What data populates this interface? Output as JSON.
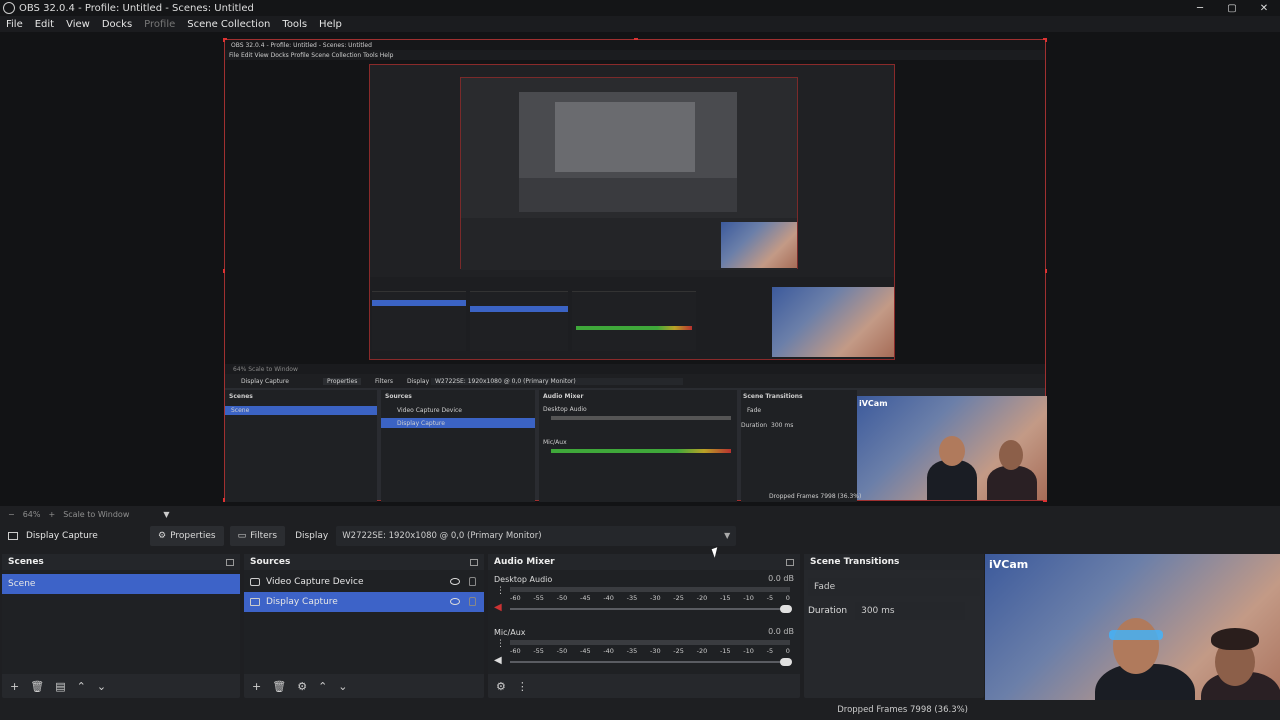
{
  "window": {
    "title": "OBS 32.0.4 - Profile: Untitled - Scenes: Untitled",
    "minimize": "─",
    "maximize": "▢",
    "close": "✕"
  },
  "menu": [
    "File",
    "Edit",
    "View",
    "Docks",
    "Profile",
    "Scene Collection",
    "Tools",
    "Help"
  ],
  "nested": {
    "title": "OBS 32.0.4 - Profile: Untitled - Scenes: Untitled",
    "menu": "File   Edit   View   Docks   Profile   Scene Collection   Tools   Help",
    "zoom": "64%   Scale to Window",
    "source_name": "Display Capture",
    "properties": "Properties",
    "filters": "Filters",
    "display_label": "Display",
    "display_value": "W2722SE: 1920x1080 @ 0,0 (Primary Monitor)",
    "scenes": "Scenes",
    "scene_item": "Scene",
    "sources": "Sources",
    "src1": "Video Capture Device",
    "src2": "Display Capture",
    "mixer": "Audio Mixer",
    "desktop": "Desktop Audio",
    "mic": "Mic/Aux",
    "transitions": "Scene Transitions",
    "fade": "Fade",
    "duration": "Duration",
    "duration_val": "300 ms",
    "dropped": "Dropped Frames 7998 (36.3%)",
    "cam": "iVCam"
  },
  "zoombar": {
    "minus": "−",
    "percent": "64%",
    "plus": "+",
    "scale": "Scale to Window",
    "caret": "▼"
  },
  "sourcebar": {
    "source_name": "Display Capture",
    "properties": "Properties",
    "filters": "Filters",
    "display_label": "Display",
    "display_value": "W2722SE: 1920x1080 @ 0,0 (Primary Monitor)",
    "caret": "▼"
  },
  "scenes": {
    "title": "Scenes",
    "items": [
      "Scene"
    ]
  },
  "sources": {
    "title": "Sources",
    "items": [
      "Video Capture Device",
      "Display Capture"
    ]
  },
  "mixer": {
    "title": "Audio Mixer",
    "channels": [
      {
        "name": "Desktop Audio",
        "db": "0.0 dB",
        "level": 0.0
      },
      {
        "name": "Mic/Aux",
        "db": "0.0 dB",
        "level": 0.9
      }
    ],
    "scale": [
      "-60",
      "-55",
      "-50",
      "-45",
      "-40",
      "-35",
      "-30",
      "-25",
      "-20",
      "-15",
      "-10",
      "-5",
      "0"
    ]
  },
  "transitions": {
    "title": "Scene Transitions",
    "type": "Fade",
    "duration_label": "Duration",
    "duration": "300 ms"
  },
  "camera": {
    "label": "iVCam"
  },
  "status": {
    "dropped": "Dropped Frames 7998 (36.3%)"
  },
  "colors": {
    "accent": "#3d63c8",
    "border": "#a03030",
    "meter_green": "#3fa83a",
    "meter_yellow": "#b9a227",
    "meter_red": "#b8312f"
  }
}
